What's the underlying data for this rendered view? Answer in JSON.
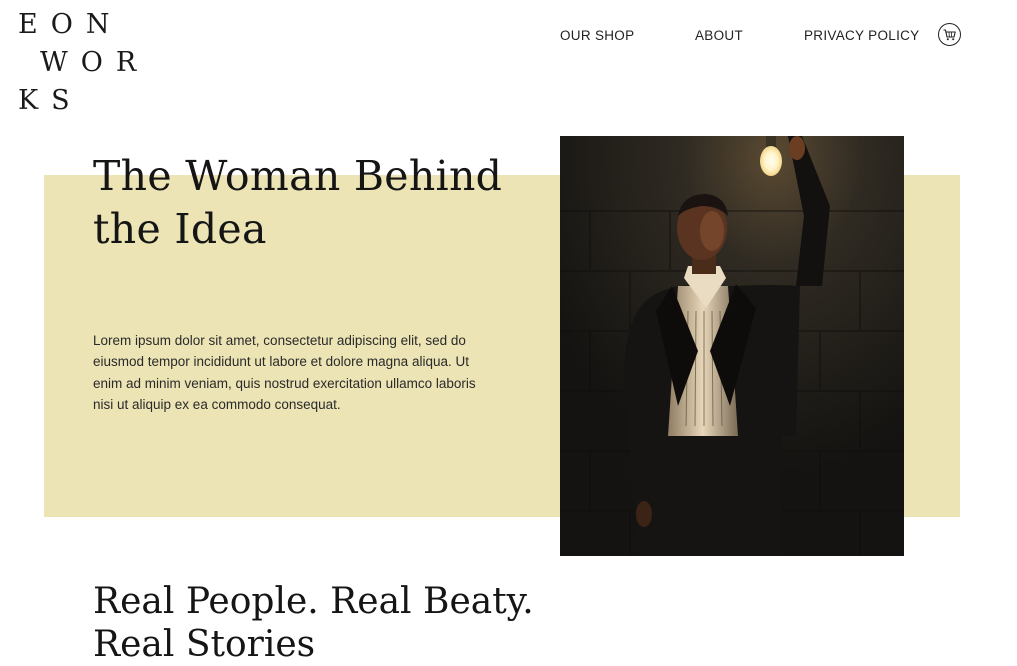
{
  "brand": {
    "line1": "EON",
    "line2": "WOR",
    "line3": "KS"
  },
  "nav": {
    "items": [
      {
        "label": "OUR SHOP"
      },
      {
        "label": "ABOUT"
      },
      {
        "label": "PRIVACY POLICY"
      }
    ],
    "cart_icon": "cart-icon"
  },
  "hero": {
    "title": "The Woman Behind the Idea",
    "body": "Lorem ipsum dolor sit amet, consectetur adipiscing elit, sed do eiusmod tempor incididunt ut labore et dolore magna aliqua. Ut enim ad minim veniam, quis nostrud exercitation ullamco laboris nisi ut aliquip ex ea commodo consequat.",
    "band_color": "#ece4b5"
  },
  "section2": {
    "title": "Real People. Real Beaty. Real Stories"
  }
}
